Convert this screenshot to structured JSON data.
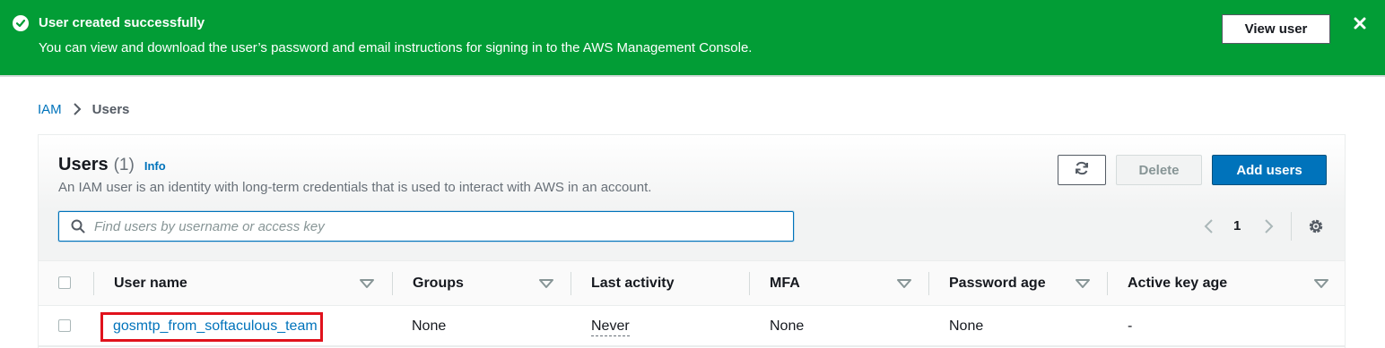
{
  "flash": {
    "title": "User created successfully",
    "message": "You can view and download the user’s password and email instructions for signing in to the AWS Management Console.",
    "button_label": "View user",
    "icons": {
      "status": "check-circle-icon",
      "close": "close-icon"
    },
    "color": "#029d36"
  },
  "breadcrumb": {
    "root": "IAM",
    "current": "Users"
  },
  "users_panel": {
    "title": "Users",
    "count": "(1)",
    "info_label": "Info",
    "description": "An IAM user is an identity with long-term credentials that is used to interact with AWS in an account.",
    "buttons": {
      "refresh_icon": "refresh-icon",
      "delete_label": "Delete",
      "add_label": "Add users"
    },
    "search": {
      "placeholder": "Find users by username or access key",
      "value": ""
    },
    "pagination": {
      "current_page": "1"
    }
  },
  "table": {
    "columns": [
      "User name",
      "Groups",
      "Last activity",
      "MFA",
      "Password age",
      "Active key age"
    ],
    "rows": [
      {
        "user_name": "gosmtp_from_softaculous_team",
        "groups": "None",
        "last_activity": "Never",
        "mfa": "None",
        "password_age": "None",
        "active_key_age": "-"
      }
    ]
  },
  "colors": {
    "accent": "#0073bb",
    "success": "#029d36",
    "highlight_border": "#e0121c"
  }
}
